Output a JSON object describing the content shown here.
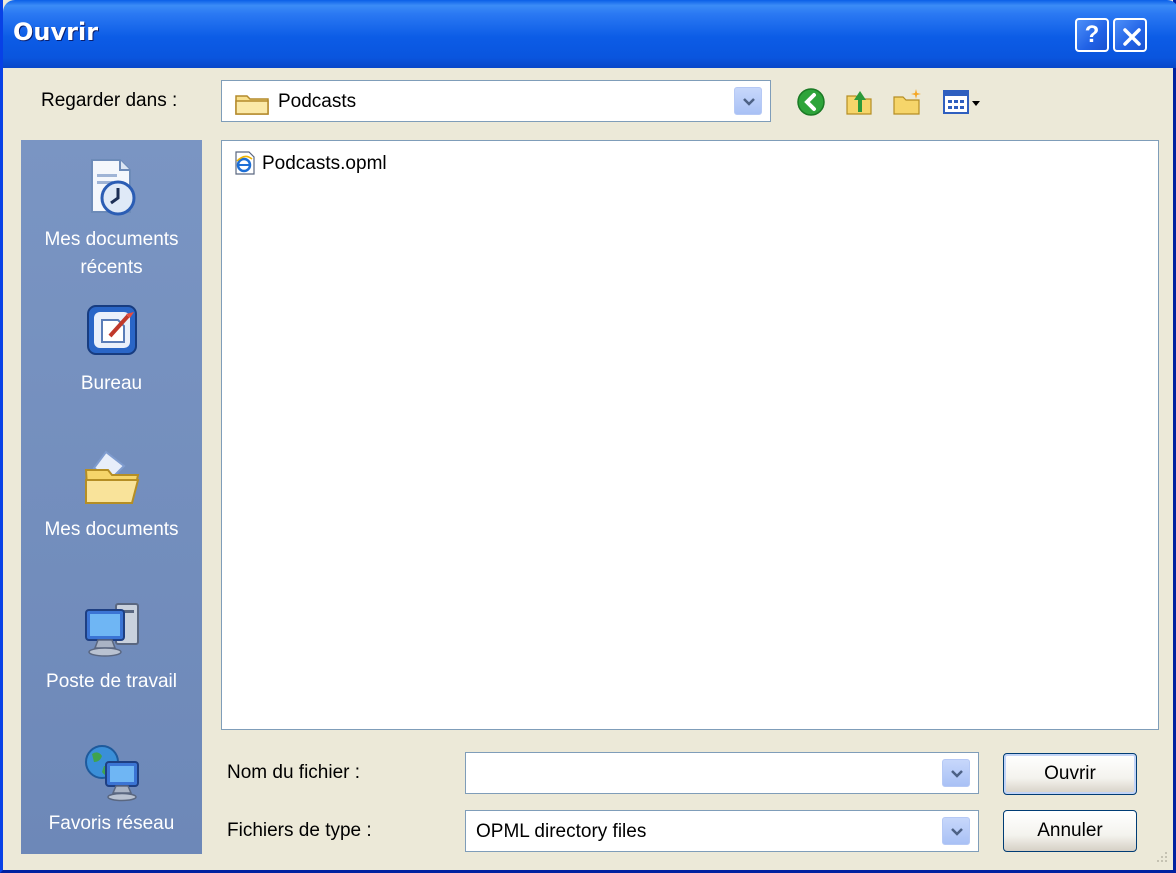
{
  "window": {
    "title": "Ouvrir",
    "help_button": "?",
    "close_icon": "close-icon"
  },
  "lookin": {
    "label": "Regarder dans :",
    "value": "Podcasts",
    "icon": "folder-icon"
  },
  "toolbar": {
    "back": "back-arrow-icon",
    "up": "up-folder-icon",
    "new_folder": "new-folder-icon",
    "views": "views-menu-icon"
  },
  "places": {
    "items": [
      {
        "label_lines": [
          "Mes documents",
          "récents"
        ],
        "icon": "recent-documents-icon"
      },
      {
        "label_lines": [
          "Bureau"
        ],
        "icon": "desktop-icon"
      },
      {
        "label_lines": [
          "Mes documents"
        ],
        "icon": "my-documents-icon"
      },
      {
        "label_lines": [
          "Poste de travail"
        ],
        "icon": "my-computer-icon"
      },
      {
        "label_lines": [
          "Favoris réseau"
        ],
        "icon": "network-places-icon"
      }
    ]
  },
  "files": [
    {
      "name": "Podcasts.opml",
      "icon": "ie-document-icon"
    }
  ],
  "filename": {
    "label": "Nom du fichier :",
    "value": ""
  },
  "filetype": {
    "label": "Fichiers de type :",
    "value": "OPML directory files"
  },
  "buttons": {
    "open": "Ouvrir",
    "cancel": "Annuler"
  }
}
